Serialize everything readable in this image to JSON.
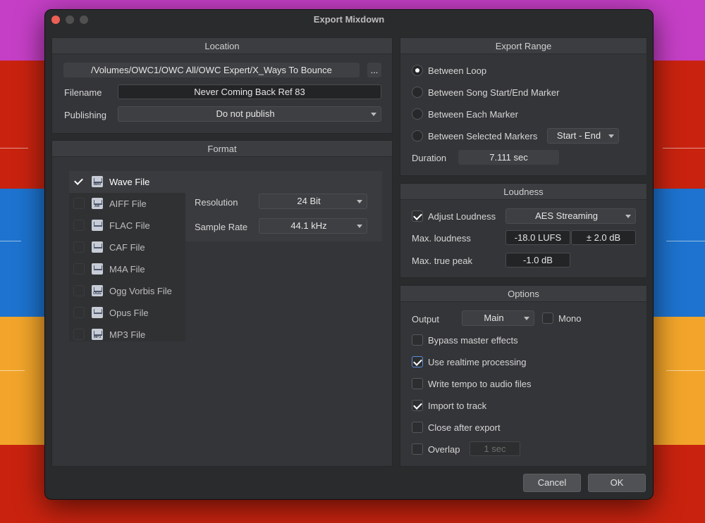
{
  "window": {
    "title": "Export Mixdown"
  },
  "location": {
    "header": "Location",
    "path": "/Volumes/OWC1/OWC All/OWC Expert/X_Ways To Bounce",
    "browse_label": "...",
    "filename_label": "Filename",
    "filename_value": "Never Coming Back Ref 83",
    "publishing_label": "Publishing",
    "publishing_value": "Do not publish"
  },
  "format": {
    "header": "Format",
    "items": [
      {
        "label": "Wave File",
        "tag": "WAV",
        "checked": true
      },
      {
        "label": "AIFF File",
        "tag": "AIF",
        "checked": false
      },
      {
        "label": "FLAC File",
        "tag": "",
        "checked": false
      },
      {
        "label": "CAF File",
        "tag": "",
        "checked": false
      },
      {
        "label": "M4A File",
        "tag": "",
        "checked": false
      },
      {
        "label": "Ogg Vorbis File",
        "tag": "OGG",
        "checked": false
      },
      {
        "label": "Opus File",
        "tag": "",
        "checked": false
      },
      {
        "label": "MP3 File",
        "tag": "MP3",
        "checked": false
      }
    ],
    "resolution_label": "Resolution",
    "resolution_value": "24 Bit",
    "sample_rate_label": "Sample Rate",
    "sample_rate_value": "44.1 kHz"
  },
  "export_range": {
    "header": "Export Range",
    "options": [
      {
        "label": "Between Loop",
        "selected": true
      },
      {
        "label": "Between Song Start/End Marker",
        "selected": false
      },
      {
        "label": "Between Each Marker",
        "selected": false
      },
      {
        "label": "Between Selected Markers",
        "selected": false
      }
    ],
    "markers_value": "Start - End",
    "duration_label": "Duration",
    "duration_value": "7.111 sec"
  },
  "loudness": {
    "header": "Loudness",
    "adjust_label": "Adjust Loudness",
    "adjust_checked": true,
    "preset_value": "AES Streaming",
    "max_loudness_label": "Max. loudness",
    "max_loudness_value": "-18.0 LUFS",
    "tolerance_value": "± 2.0 dB",
    "true_peak_label": "Max. true peak",
    "true_peak_value": "-1.0 dB"
  },
  "options": {
    "header": "Options",
    "output_label": "Output",
    "output_value": "Main",
    "mono_label": "Mono",
    "mono_checked": false,
    "checks": [
      {
        "label": "Bypass master effects",
        "checked": false
      },
      {
        "label": "Use realtime processing",
        "checked": true
      },
      {
        "label": "Write tempo to audio files",
        "checked": false
      },
      {
        "label": "Import to track",
        "checked": true
      },
      {
        "label": "Close after export",
        "checked": false
      },
      {
        "label": "Overlap",
        "checked": false
      }
    ],
    "overlap_value": "1 sec"
  },
  "buttons": {
    "cancel_label": "Cancel",
    "ok_label": "OK"
  },
  "colors": {
    "track_magenta": "#c53fc6",
    "track_red": "#c9230f",
    "track_blue": "#1d73cf",
    "track_orange": "#f2a52a",
    "window_bg": "#2a2b2d",
    "close_red": "#ed5f55"
  }
}
